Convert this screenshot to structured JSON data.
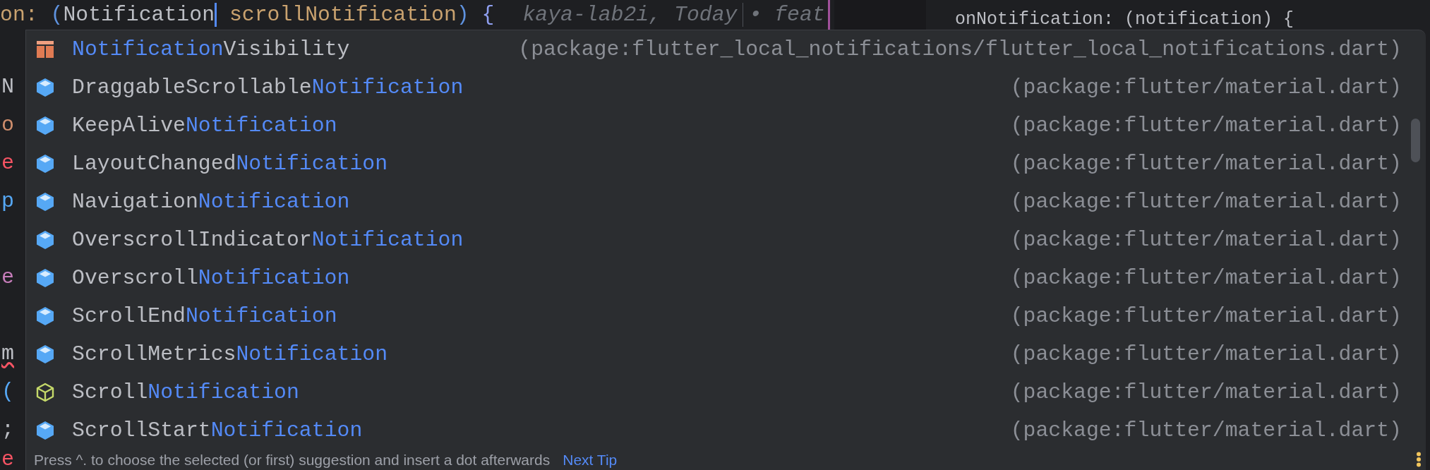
{
  "editor": {
    "tokens": [
      {
        "text": "on:",
        "kind": "param"
      },
      {
        "text": "(",
        "kind": "punct"
      },
      {
        "text": "Notification",
        "kind": "type"
      },
      {
        "kind": "caret"
      },
      {
        "text": "scrollNotification",
        "kind": "param"
      },
      {
        "text": ")",
        "kind": "punct"
      },
      {
        "text": "{",
        "kind": "brace"
      }
    ],
    "blame": {
      "author_time": "kaya-lab2i, Today",
      "message": "• feat"
    }
  },
  "side_editor": {
    "code": "onNotification: (notification) {"
  },
  "gutter": [
    {
      "text": "N",
      "color": "#bcbec4",
      "error": false
    },
    {
      "text": "o",
      "color": "#cf8e6d",
      "error": false
    },
    {
      "text": "e",
      "color": "#f75464",
      "error": false
    },
    {
      "text": "p",
      "color": "#56a8f5",
      "error": false
    },
    {
      "text": "e",
      "color": "#c77dbb",
      "error": false
    },
    {
      "text": "m",
      "color": "#bcbec4",
      "error": true
    },
    {
      "text": "(",
      "color": "#56a8f5",
      "error": false
    },
    {
      "text": ";",
      "color": "#bcbec4",
      "error": false
    },
    {
      "text": "e",
      "color": "#f75464",
      "error": false
    }
  ],
  "completion": {
    "items": [
      {
        "kind": "enum",
        "parts": [
          {
            "text": "Notification",
            "matched": true
          },
          {
            "text": "Visibility",
            "matched": false
          }
        ],
        "source": "(package:flutter_local_notifications/flutter_local_notifications.dart)"
      },
      {
        "kind": "class",
        "parts": [
          {
            "text": "DraggableScrollable",
            "matched": false
          },
          {
            "text": "Notification",
            "matched": true
          }
        ],
        "source": "(package:flutter/material.dart)"
      },
      {
        "kind": "class",
        "parts": [
          {
            "text": "KeepAlive",
            "matched": false
          },
          {
            "text": "Notification",
            "matched": true
          }
        ],
        "source": "(package:flutter/material.dart)"
      },
      {
        "kind": "class",
        "parts": [
          {
            "text": "LayoutChanged",
            "matched": false
          },
          {
            "text": "Notification",
            "matched": true
          }
        ],
        "source": "(package:flutter/material.dart)"
      },
      {
        "kind": "class",
        "parts": [
          {
            "text": "Navigation",
            "matched": false
          },
          {
            "text": "Notification",
            "matched": true
          }
        ],
        "source": "(package:flutter/material.dart)"
      },
      {
        "kind": "class",
        "parts": [
          {
            "text": "OverscrollIndicator",
            "matched": false
          },
          {
            "text": "Notification",
            "matched": true
          }
        ],
        "source": "(package:flutter/material.dart)"
      },
      {
        "kind": "class",
        "parts": [
          {
            "text": "Overscroll",
            "matched": false
          },
          {
            "text": "Notification",
            "matched": true
          }
        ],
        "source": "(package:flutter/material.dart)"
      },
      {
        "kind": "class",
        "parts": [
          {
            "text": "ScrollEnd",
            "matched": false
          },
          {
            "text": "Notification",
            "matched": true
          }
        ],
        "source": "(package:flutter/material.dart)"
      },
      {
        "kind": "class",
        "parts": [
          {
            "text": "ScrollMetrics",
            "matched": false
          },
          {
            "text": "Notification",
            "matched": true
          }
        ],
        "source": "(package:flutter/material.dart)"
      },
      {
        "kind": "abstract",
        "parts": [
          {
            "text": "Scroll",
            "matched": false
          },
          {
            "text": "Notification",
            "matched": true
          }
        ],
        "source": "(package:flutter/material.dart)"
      },
      {
        "kind": "class",
        "parts": [
          {
            "text": "ScrollStart",
            "matched": false
          },
          {
            "text": "Notification",
            "matched": true
          }
        ],
        "source": "(package:flutter/material.dart)"
      }
    ],
    "footer": {
      "hint": "Press ^. to choose the selected (or first) suggestion and insert a dot afterwards",
      "link": "Next Tip"
    }
  }
}
